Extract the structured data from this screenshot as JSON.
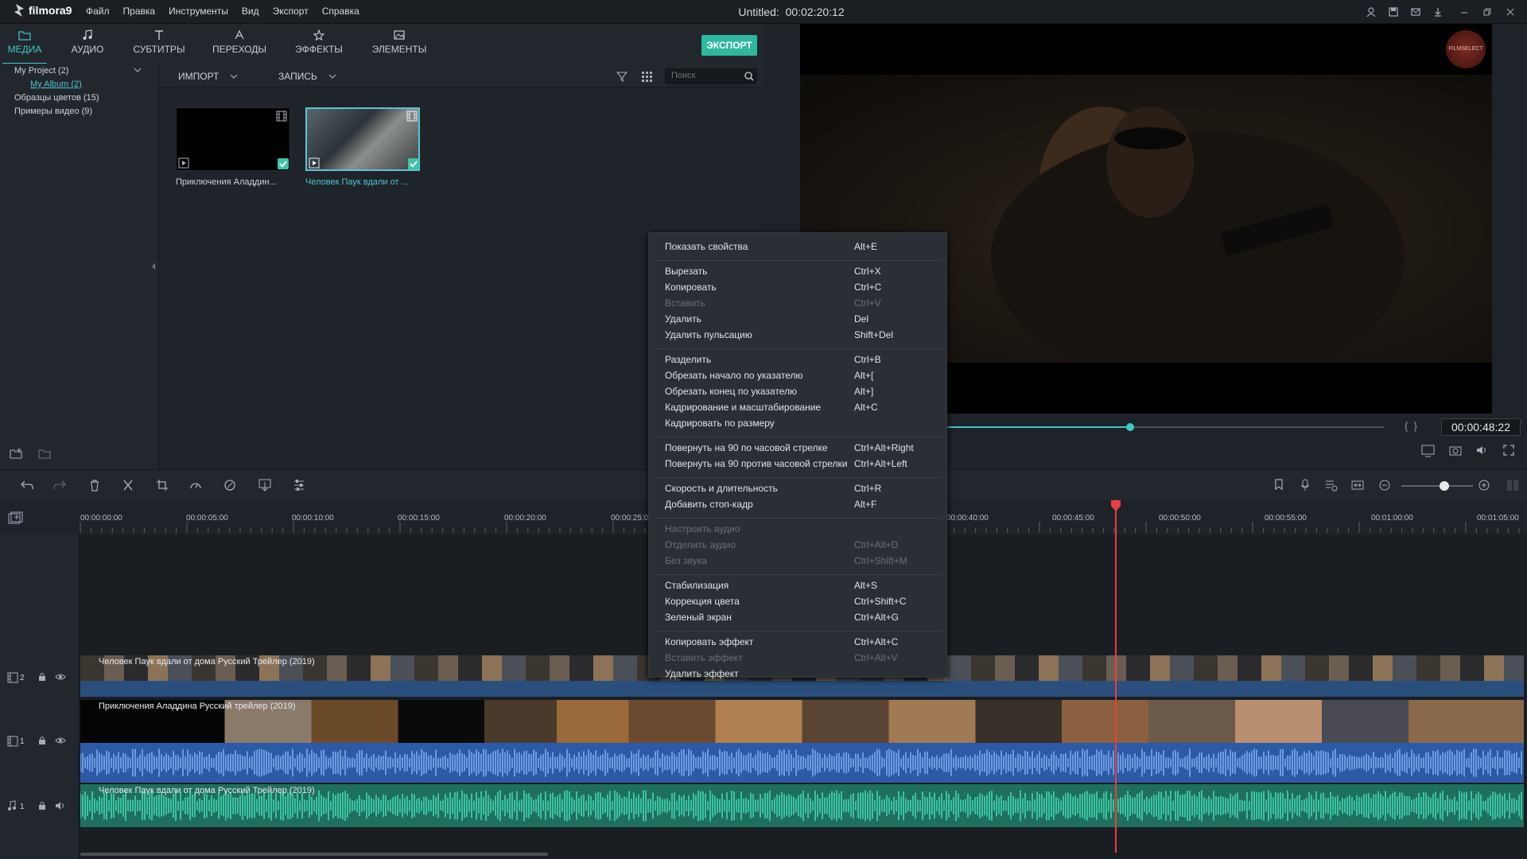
{
  "app": {
    "name": "filmora9",
    "title": "Untitled:",
    "timecode": "00:02:20:12"
  },
  "menu": [
    "Файл",
    "Правка",
    "Инструменты",
    "Вид",
    "Экспорт",
    "Справка"
  ],
  "media_tabs": [
    {
      "label": "МЕДИА",
      "icon": "folder-icon",
      "active": true
    },
    {
      "label": "АУДИО",
      "icon": "music-note-icon"
    },
    {
      "label": "СУБТИТРЫ",
      "icon": "text-icon"
    },
    {
      "label": "ПЕРЕХОДЫ",
      "icon": "transition-icon"
    },
    {
      "label": "ЭФФЕКТЫ",
      "icon": "effects-icon"
    },
    {
      "label": "ЭЛЕМЕНТЫ",
      "icon": "image-icon"
    }
  ],
  "export_label": "ЭКСПОРТ",
  "sidebar": {
    "items": [
      {
        "label": "My Project (2)"
      },
      {
        "label": "My Album (2)"
      },
      {
        "label": "Образцы цветов (15)"
      },
      {
        "label": "Примеры видео (9)"
      }
    ]
  },
  "media_toolbar": {
    "import": "ИМПОРТ",
    "record": "ЗАПИСЬ",
    "search_placeholder": "Поиск"
  },
  "media_items": [
    {
      "name": "Приключения Аладдин..."
    },
    {
      "name": "Человек Паук  вдали от ..."
    }
  ],
  "preview": {
    "time": "00:00:48:22",
    "progress": 0.42,
    "watermark": "FILMSELECT"
  },
  "context_menu": [
    {
      "label": "Показать свойства",
      "shortcut": "Alt+E"
    },
    {
      "label": "Вырезать",
      "shortcut": "Ctrl+X",
      "sep_before": true
    },
    {
      "label": "Копировать",
      "shortcut": "Ctrl+C"
    },
    {
      "label": "Вставить",
      "shortcut": "Ctrl+V",
      "disabled": true
    },
    {
      "label": "Удалить",
      "shortcut": "Del"
    },
    {
      "label": "Удалить пульсацию",
      "shortcut": "Shift+Del"
    },
    {
      "label": "Разделить",
      "shortcut": "Ctrl+B",
      "sep_before": true
    },
    {
      "label": "Обрезать начало по указателю",
      "shortcut": "Alt+["
    },
    {
      "label": "Обрезать конец по указателю",
      "shortcut": "Alt+]"
    },
    {
      "label": "Кадрирование и масштабирование",
      "shortcut": "Alt+C"
    },
    {
      "label": "Кадрировать по размеру",
      "shortcut": ""
    },
    {
      "label": "Повернуть на 90 по часовой стрелке",
      "shortcut": "Ctrl+Alt+Right",
      "sep_before": true
    },
    {
      "label": "Повернуть на 90 против часовой стрелки",
      "shortcut": "Ctrl+Alt+Left"
    },
    {
      "label": "Скорость и длительность",
      "shortcut": "Ctrl+R",
      "sep_before": true
    },
    {
      "label": "Добавить стоп-кадр",
      "shortcut": "Alt+F"
    },
    {
      "label": "Настроить аудио",
      "shortcut": "",
      "disabled": true,
      "sep_before": true
    },
    {
      "label": "Отделить аудио",
      "shortcut": "Ctrl+Alt+D",
      "disabled": true
    },
    {
      "label": "Без звука",
      "shortcut": "Ctrl+Shift+M",
      "disabled": true
    },
    {
      "label": "Стабилизация",
      "shortcut": "Alt+S",
      "sep_before": true
    },
    {
      "label": "Коррекция цвета",
      "shortcut": "Ctrl+Shift+C"
    },
    {
      "label": "Зеленый экран",
      "shortcut": "Ctrl+Alt+G"
    },
    {
      "label": "Копировать эффект",
      "shortcut": "Ctrl+Alt+C",
      "sep_before": true
    },
    {
      "label": "Вставить эффект",
      "shortcut": "Ctrl+Alt+V",
      "disabled": true
    },
    {
      "label": "Удалить эффект",
      "shortcut": ""
    }
  ],
  "ruler_labels": [
    "00:00:00:00",
    "00:00:05:00",
    "00:00:10:00",
    "00:00:15:00",
    "00:00:20:00",
    "00:00:25:00",
    "00:00:40:00",
    "00:00:45:00",
    "00:00:50:00",
    "00:00:55:00",
    "00:01:00:00",
    "00:01:05:00"
  ],
  "tracks": {
    "v2": {
      "num": "2",
      "clip": "Человек Паук  вдали от дома Русский Трейлер (2019)"
    },
    "v1": {
      "num": "1",
      "clip": "Приключения Аладдина Русский трейлер (2019)"
    },
    "a1": {
      "num": "1",
      "clip": "Человек Паук  вдали от дома Русский Трейлер (2019)"
    }
  },
  "zoom_level": 0.6,
  "colors": {
    "accent": "#3fc7c7",
    "export": "#2fb8a0",
    "playhead": "#e84040",
    "audio": "#2fa68a",
    "audio_blue": "#3f6fb8"
  }
}
